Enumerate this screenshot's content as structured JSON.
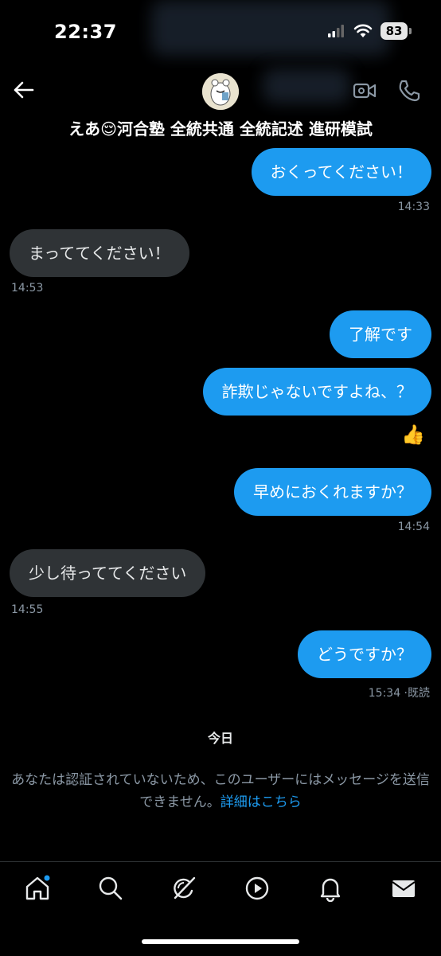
{
  "status_bar": {
    "time": "22:37",
    "battery": "83"
  },
  "header": {
    "name": "えあ😌河合塾 全統共通 全統記述 進研模試"
  },
  "messages": [
    {
      "text": "おくってください！",
      "dir": "out"
    },
    {
      "text": "14:33",
      "kind": "ts"
    },
    {
      "text": "まっててください！",
      "dir": "in"
    },
    {
      "text": "14:53",
      "kind": "ts"
    },
    {
      "text": "了解です",
      "dir": "out"
    },
    {
      "text": "詐欺じゃないですよね、？",
      "dir": "out"
    },
    {
      "text": "👍",
      "kind": "reaction"
    },
    {
      "text": "早めにおくれますか？",
      "dir": "out"
    },
    {
      "text": "14:54",
      "kind": "ts"
    },
    {
      "text": "少し待っててください",
      "dir": "in"
    },
    {
      "text": "14:55",
      "kind": "ts"
    },
    {
      "text": "どうですか？",
      "dir": "out"
    },
    {
      "text": "15:34 ·既読",
      "kind": "ts"
    }
  ],
  "day_separator": "今日",
  "notice": {
    "text": "あなたは認証されていないため、このユーザーにはメッセージを送信できません。",
    "link": "詳細はこちら"
  },
  "nav": {
    "items": [
      "home-icon",
      "search-icon",
      "grok-icon",
      "play-icon",
      "bell-icon",
      "mail-icon"
    ]
  },
  "colors": {
    "accent": "#1d9bf0",
    "incoming": "#2f3336",
    "background": "#000000"
  }
}
